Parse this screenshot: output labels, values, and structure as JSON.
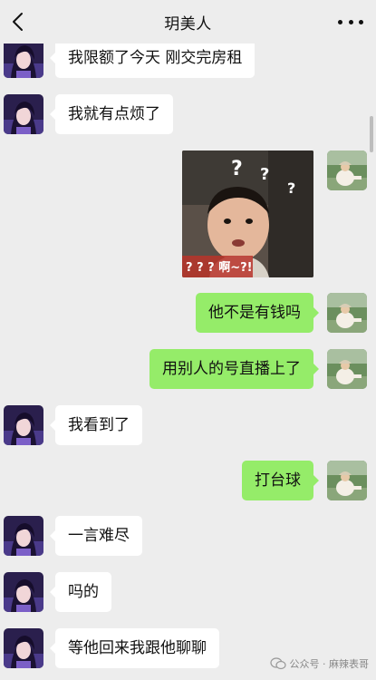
{
  "header": {
    "title": "玥美人",
    "back_icon": "chevron-left-icon",
    "more_icon": "more-dots-icon"
  },
  "messages": [
    {
      "side": "in",
      "type": "text",
      "text": "我限额了今天 刚交完房租"
    },
    {
      "side": "in",
      "type": "text",
      "text": "我就有点烦了"
    },
    {
      "side": "out",
      "type": "sticker",
      "sticker_text": "?  ?  ?  啊~?!"
    },
    {
      "side": "out",
      "type": "text",
      "text": "他不是有钱吗"
    },
    {
      "side": "out",
      "type": "text",
      "text": "用别人的号直播上了"
    },
    {
      "side": "in",
      "type": "text",
      "text": "我看到了"
    },
    {
      "side": "out",
      "type": "text",
      "text": "打台球"
    },
    {
      "side": "in",
      "type": "text",
      "text": "一言难尽"
    },
    {
      "side": "in",
      "type": "text",
      "text": "吗的"
    },
    {
      "side": "in",
      "type": "text",
      "text": "等他回来我跟他聊聊"
    }
  ],
  "watermark": {
    "text": "公众号 · 麻辣表哥"
  },
  "colors": {
    "background": "#ededed",
    "incoming_bubble": "#ffffff",
    "outgoing_bubble": "#95ec69"
  }
}
